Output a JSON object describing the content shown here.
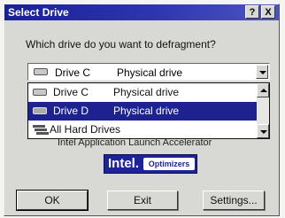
{
  "window": {
    "title": "Select Drive",
    "help_label": "?",
    "close_label": "X"
  },
  "prompt": "Which drive do you want to defragment?",
  "combo": {
    "selected_name": "Drive C",
    "selected_type": "Physical drive"
  },
  "dropdown": {
    "items": [
      {
        "name": "Drive C",
        "type": "Physical drive",
        "icon": "hard-drive-icon",
        "selected": false
      },
      {
        "name": "Drive D",
        "type": "Physical drive",
        "icon": "hard-drive-icon",
        "selected": true
      },
      {
        "name": "All Hard Drives",
        "type": "",
        "icon": "stacked-drives-icon",
        "selected": false
      }
    ]
  },
  "accelerator_text": "Intel Application Launch Accelerator",
  "logo": {
    "word": "Intel.",
    "tag": "Optimizers"
  },
  "buttons": {
    "ok": "OK",
    "exit": "Exit",
    "settings": "Settings..."
  }
}
